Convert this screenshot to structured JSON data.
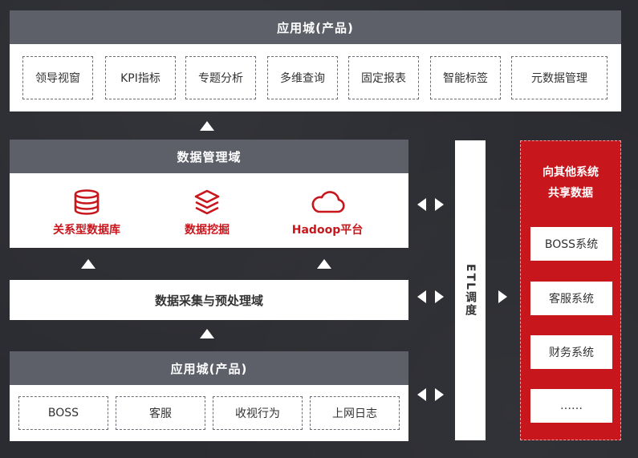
{
  "top": {
    "title": "应用城(产品)",
    "items": [
      "领导视窗",
      "KPI指标",
      "专题分析",
      "多维查询",
      "固定报表",
      "智能标签",
      "元数据管理"
    ]
  },
  "data_mgmt": {
    "title": "数据管理域",
    "items": [
      {
        "label": "关系型数据库",
        "icon": "database-icon"
      },
      {
        "label": "数据挖掘",
        "icon": "layers-icon"
      },
      {
        "label": "Hadoop平台",
        "icon": "cloud-icon"
      }
    ]
  },
  "collect": {
    "title": "数据采集与预处理域"
  },
  "bottom": {
    "title": "应用城(产品)",
    "items": [
      "BOSS",
      "客服",
      "收视行为",
      "上网日志"
    ]
  },
  "etl": {
    "label": "ETL调度"
  },
  "share": {
    "title_line1": "向其他系统",
    "title_line2": "共享数据",
    "items": [
      "BOSS系统",
      "客服系统",
      "财务系统",
      "……"
    ]
  },
  "colors": {
    "background": "#2b2c31",
    "header": "#5d6069",
    "accent_red": "#c8161d",
    "panel": "#ffffff"
  }
}
